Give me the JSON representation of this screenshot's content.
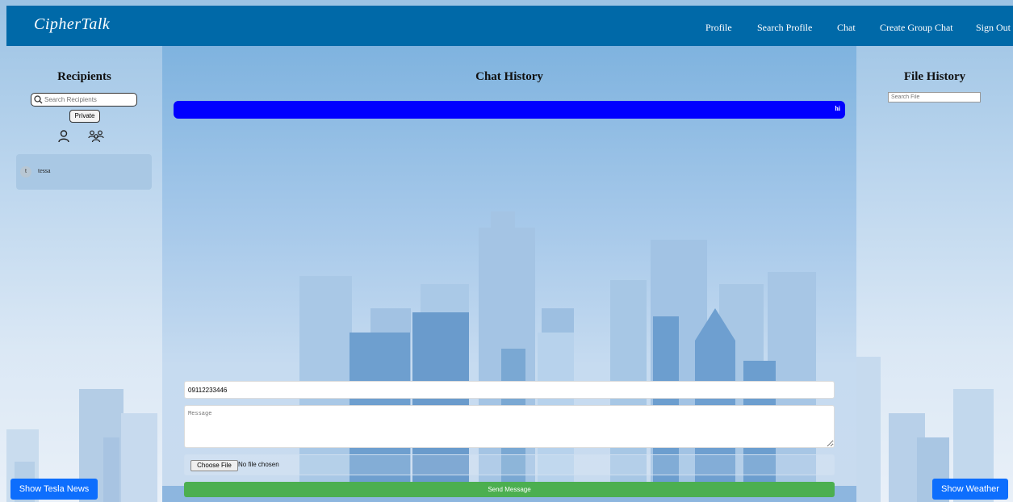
{
  "app": {
    "logo": "CipherTalk"
  },
  "nav": {
    "profile": "Profile",
    "search_profile": "Search Profile",
    "chat": "Chat",
    "create_group_chat": "Create Group Chat",
    "sign_out": "Sign Out"
  },
  "left": {
    "heading": "Recipients",
    "search_placeholder": "Search Recipients",
    "mode_button": "Private",
    "recipients": [
      {
        "initial": "t",
        "name": "tessa"
      }
    ]
  },
  "main": {
    "heading": "Chat History",
    "messages": [
      {
        "text": "hi"
      }
    ],
    "phone_value": "09112233446",
    "message_placeholder": "Message",
    "choose_file_label": "Choose File",
    "no_file_text": "No file chosen",
    "send_label": "Send Message"
  },
  "right": {
    "heading": "File History",
    "search_placeholder": "Search File"
  },
  "buttons": {
    "tesla_news": "Show Tesla News",
    "weather": "Show Weather"
  },
  "colors": {
    "navbar": "#0069a8",
    "message_bubble": "#0000ff",
    "send_button": "#4caf50",
    "action_button": "#0d6efd"
  }
}
